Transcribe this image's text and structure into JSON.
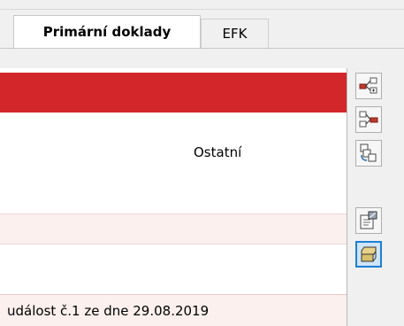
{
  "tabs": [
    {
      "label": "Primární doklady",
      "active": true
    },
    {
      "label": "EFK",
      "active": false
    }
  ],
  "grid": {
    "rows": [
      {
        "text": ""
      },
      {
        "text": "Ostatní"
      },
      {
        "text": ""
      },
      {
        "text": ""
      },
      {
        "text": "událost č.1 ze dne 29.08.2019"
      }
    ]
  },
  "toolbar": {
    "buttons": [
      {
        "icon": "add-node-icon"
      },
      {
        "icon": "remove-node-icon"
      },
      {
        "icon": "copy-tree-icon"
      },
      {
        "icon": "properties-icon"
      },
      {
        "icon": "archive-box-icon",
        "selected": true
      }
    ]
  },
  "colors": {
    "header_red": "#d3262b",
    "row_pink": "#fcf0ee",
    "selected_blue": "#1e7fd6"
  }
}
